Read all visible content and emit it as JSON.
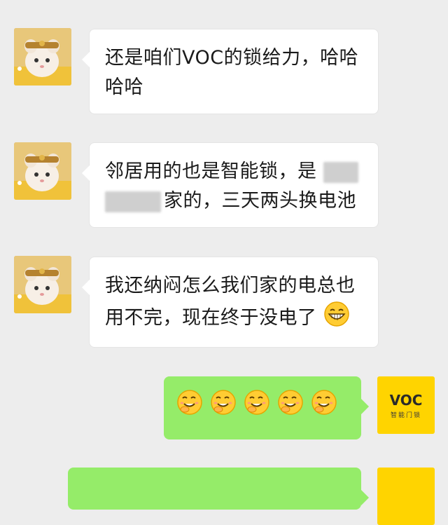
{
  "messages": [
    {
      "side": "left",
      "lines": [
        "还是咱们VOC的锁给力，哈哈",
        "哈哈"
      ]
    },
    {
      "side": "left",
      "line1": "邻居用的也是智能锁，是",
      "line2": "家的，三天两头换电池"
    },
    {
      "side": "left",
      "line1": "我还纳闷怎么我们家的电总也",
      "line2": "用不完，现在终于没电了"
    },
    {
      "side": "right",
      "emoji_count": 5,
      "emoji": "shy-grin-emoji"
    }
  ],
  "brand": {
    "logo_text": "VOC",
    "logo_sub": "智能门锁",
    "color": "#ffd400"
  },
  "colors": {
    "background": "#ededed",
    "bubble_left": "#ffffff",
    "bubble_right": "#95ec69"
  }
}
